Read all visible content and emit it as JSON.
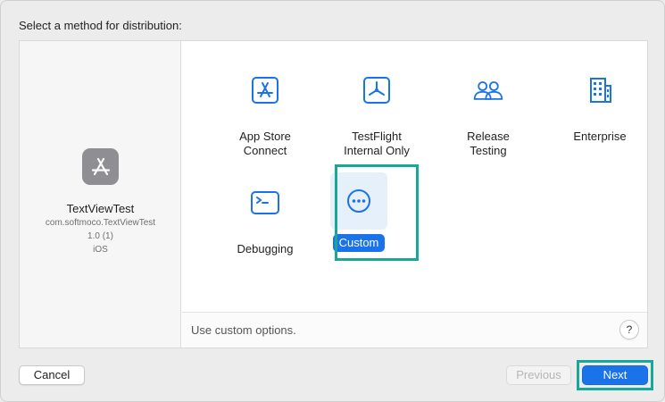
{
  "colors": {
    "accent": "#1a73e8",
    "highlight": "#17a89a",
    "icon_gray": "#8e8e93",
    "icon_blue": "#1a73e8"
  },
  "heading": "Select a method for distribution:",
  "app": {
    "icon": "app-store-icon",
    "name": "TextViewTest",
    "bundle_id": "com.softmoco.TextViewTest",
    "version": "1.0 (1)",
    "platform": "iOS"
  },
  "options": [
    {
      "id": "app-store-connect",
      "icon": "app-store-icon",
      "label_line1": "App Store",
      "label_line2": "Connect",
      "selected": false
    },
    {
      "id": "testflight-internal-only",
      "icon": "testflight-icon",
      "label_line1": "TestFlight",
      "label_line2": "Internal Only",
      "selected": false
    },
    {
      "id": "release-testing",
      "icon": "people-icon",
      "label_line1": "Release",
      "label_line2": "Testing",
      "selected": false
    },
    {
      "id": "enterprise",
      "icon": "building-icon",
      "label_line1": "Enterprise",
      "label_line2": "",
      "selected": false
    },
    {
      "id": "debugging",
      "icon": "terminal-icon",
      "label_line1": "Debugging",
      "label_line2": "",
      "selected": false
    },
    {
      "id": "custom",
      "icon": "ellipsis-circle-icon",
      "label_line1": "Custom",
      "label_line2": "",
      "selected": true
    }
  ],
  "description": "Use custom options.",
  "help_label": "?",
  "buttons": {
    "cancel": "Cancel",
    "previous": "Previous",
    "next": "Next"
  }
}
